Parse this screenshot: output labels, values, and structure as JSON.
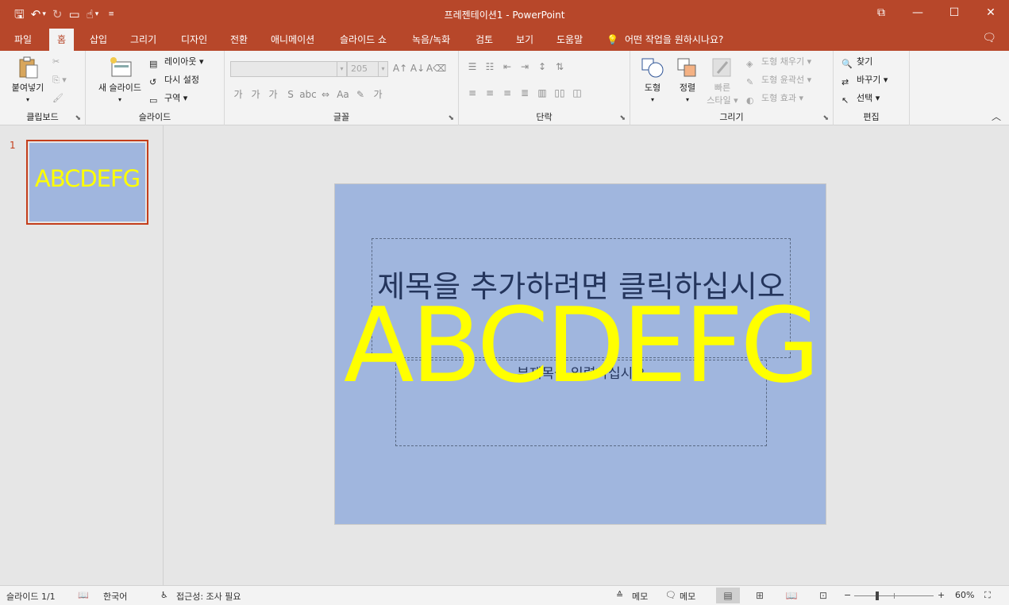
{
  "window": {
    "title": "프레젠테이션1  -  PowerPoint",
    "controls": [
      "restore-ribbon",
      "minimize",
      "maximize",
      "close"
    ]
  },
  "qat": [
    "save",
    "undo",
    "redo",
    "present-from-start",
    "touch-mode",
    "customize"
  ],
  "tabs": [
    "파일",
    "홈",
    "삽입",
    "그리기",
    "디자인",
    "전환",
    "애니메이션",
    "슬라이드 쇼",
    "녹음/녹화",
    "검토",
    "보기",
    "도움말"
  ],
  "active_tab": "홈",
  "tell_me": "어떤 작업을 원하시나요?",
  "ribbon": {
    "clipboard": {
      "label": "클립보드",
      "paste": "붙여넣기"
    },
    "slides": {
      "label": "슬라이드",
      "new_slide": "새 슬라이드",
      "layout": "레이아웃",
      "reset": "다시 설정",
      "section": "구역"
    },
    "font": {
      "label": "글꼴",
      "font_name": "",
      "font_size": "205"
    },
    "paragraph": {
      "label": "단락"
    },
    "drawing": {
      "label": "그리기",
      "shapes": "도형",
      "arrange": "정렬",
      "quick_styles_1": "빠른",
      "quick_styles_2": "스타일",
      "shape_fill": "도형 채우기",
      "shape_outline": "도형 윤곽선",
      "shape_effects": "도형 효과"
    },
    "editing": {
      "label": "편집",
      "find": "찾기",
      "replace": "바꾸기",
      "select": "선택"
    }
  },
  "thumbnails": [
    {
      "number": "1",
      "text": "ABCDEFG"
    }
  ],
  "slide": {
    "title_placeholder": "제목을 추가하려면 클릭하십시오",
    "subtitle_placeholder": "부제목을 입력하십시오",
    "overlay_text": "ABCDEFG",
    "background": "#a0b6de",
    "overlay_color": "#ffff00"
  },
  "status": {
    "slide_count": "슬라이드 1/1",
    "language": "한국어",
    "accessibility": "접근성: 조사 필요",
    "notes": "메모",
    "comments": "메모",
    "zoom": "60%"
  },
  "colors": {
    "accent": "#b7472a",
    "selected": "#c43e1c"
  }
}
